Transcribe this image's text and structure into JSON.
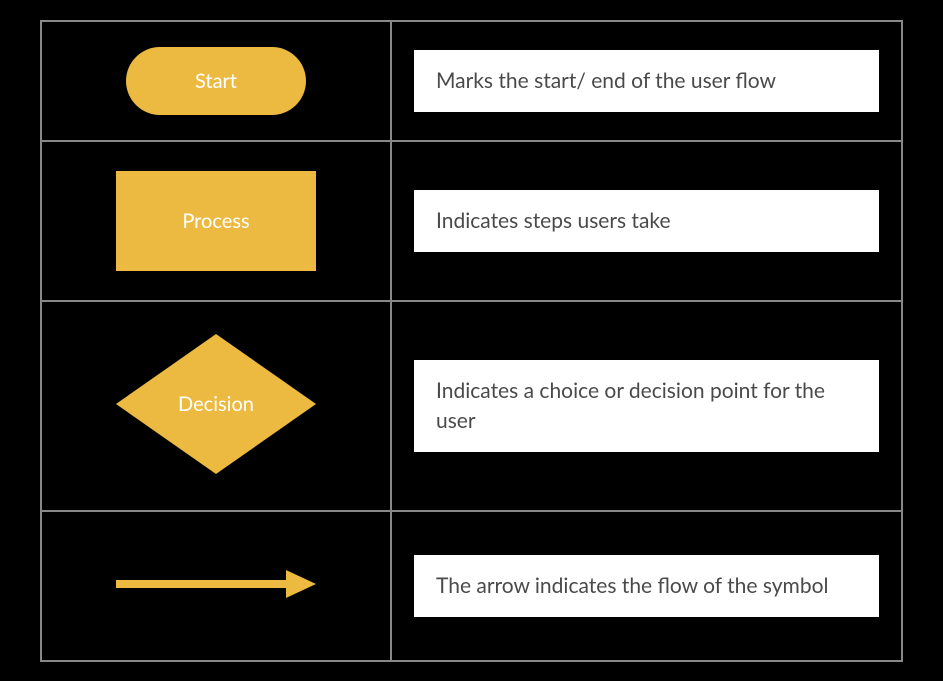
{
  "colors": {
    "shape_fill": "#edba41",
    "shape_text": "#ffffff",
    "desc_bg": "#ffffff",
    "desc_text": "#4a4a4a",
    "page_bg": "#000000",
    "border": "#888888"
  },
  "rows": [
    {
      "shape": "terminator",
      "label": "Start",
      "description": "Marks the start/ end of the user flow"
    },
    {
      "shape": "process",
      "label": "Process",
      "description": "Indicates steps users take"
    },
    {
      "shape": "decision",
      "label": "Decision",
      "description": "Indicates a choice or decision point for the user"
    },
    {
      "shape": "arrow",
      "label": "",
      "description": "The arrow indicates the flow of the symbol"
    }
  ]
}
